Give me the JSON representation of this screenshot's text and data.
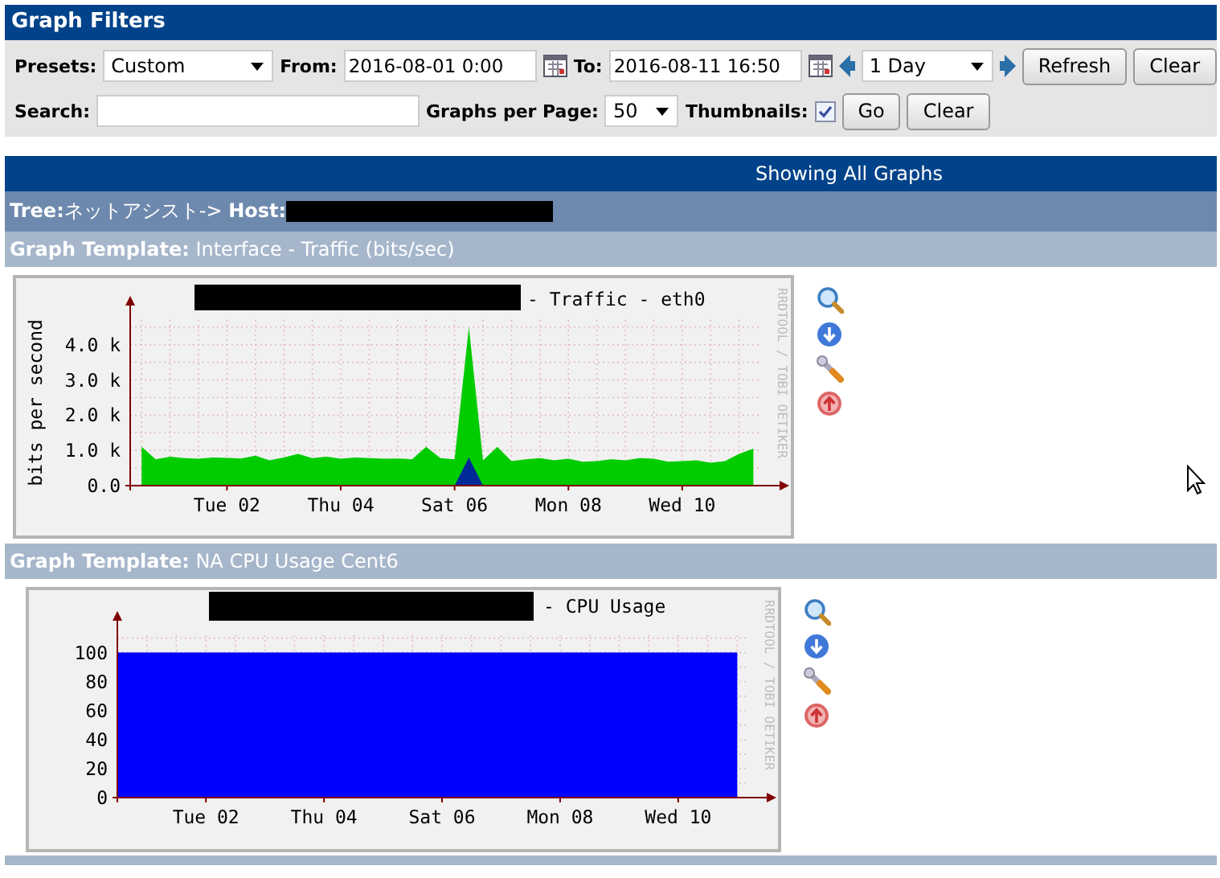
{
  "filters": {
    "title": "Graph Filters",
    "presets": {
      "label": "Presets:",
      "value": "Custom"
    },
    "from": {
      "label": "From:",
      "value": "2016-08-01 0:00"
    },
    "to": {
      "label": "To:",
      "value": "2016-08-11 16:50"
    },
    "timespan": {
      "value": "1 Day"
    },
    "buttons": [
      "Refresh",
      "Clear"
    ],
    "search": {
      "label": "Search:"
    },
    "graphs_per_page": {
      "label": "Graphs per Page:",
      "value": "50"
    },
    "thumbnails": {
      "label": "Thumbnails:",
      "checked": true
    },
    "buttons_2": [
      "Go",
      "Clear"
    ]
  },
  "banner": "Showing All Graphs",
  "tree": {
    "tree_label": "Tree:",
    "tree_value": "ネットアシスト->",
    "host_label": "Host:"
  },
  "sections": [
    {
      "template_label": "Graph Template:",
      "template_name": "Interface - Traffic (bits/sec)",
      "graph": {
        "title": "- Traffic - eth0",
        "watermark": "RRDTOOL / TOBI OETIKER",
        "chart_data": {
          "type": "area",
          "ylabel": "bits per second",
          "categories": [
            null,
            null,
            null,
            null,
            null,
            null,
            "Tue 02",
            null,
            null,
            null,
            null,
            null,
            null,
            null,
            "Thu 04",
            null,
            null,
            null,
            null,
            null,
            null,
            null,
            "Sat 06",
            null,
            null,
            null,
            null,
            null,
            null,
            null,
            "Mon 08",
            null,
            null,
            null,
            null,
            null,
            null,
            null,
            "Wed 10",
            null,
            null,
            null,
            null,
            null
          ],
          "series": [
            {
              "color": "#00cc00",
              "values": [
                1100,
                750,
                820,
                780,
                760,
                800,
                790,
                770,
                850,
                720,
                800,
                900,
                780,
                820,
                760,
                800,
                780,
                760,
                770,
                750,
                1100,
                780,
                750,
                4500,
                720,
                1100,
                700,
                750,
                780,
                720,
                760,
                680,
                700,
                750,
                720,
                780,
                760,
                680,
                700,
                720,
                650,
                700,
                900,
                1050
              ]
            },
            {
              "color": "#002a97",
              "values": [
                0,
                0,
                0,
                0,
                0,
                0,
                0,
                0,
                0,
                0,
                0,
                0,
                0,
                0,
                0,
                0,
                0,
                0,
                0,
                0,
                0,
                0,
                0,
                800,
                0,
                0,
                0,
                0,
                0,
                0,
                0,
                0,
                0,
                0,
                0,
                0,
                0,
                0,
                0,
                0,
                0,
                0,
                0,
                0
              ]
            }
          ],
          "ylim": [
            0,
            4700
          ],
          "grid": true,
          "yticks": [
            {
              "value": 0,
              "label": "0.0"
            },
            {
              "value": 1000,
              "label": "1.0 k"
            },
            {
              "value": 2000,
              "label": "2.0 k"
            },
            {
              "value": 3000,
              "label": "3.0 k"
            },
            {
              "value": 4000,
              "label": "4.0 k"
            }
          ]
        }
      }
    },
    {
      "template_label": "Graph Template:",
      "template_name": "NA CPU Usage Cent6",
      "graph": {
        "title": "- CPU Usage",
        "watermark": "RRDTOOL / TOBI OETIKER",
        "chart_data": {
          "type": "area",
          "categories": [
            null,
            null,
            null,
            "Tue 02",
            null,
            null,
            null,
            "Thu 04",
            null,
            null,
            null,
            "Sat 06",
            null,
            null,
            null,
            "Mon 08",
            null,
            null,
            null,
            "Wed 10",
            null,
            null
          ],
          "series": [
            {
              "color": "#0000ff",
              "values": [
                100,
                100,
                100,
                100,
                100,
                100,
                100,
                100,
                100,
                100,
                100,
                100,
                100,
                100,
                100,
                100,
                100,
                100,
                100,
                100,
                100,
                100
              ]
            }
          ],
          "ylim": [
            0,
            112
          ],
          "grid": true,
          "yticks": [
            0,
            20,
            40,
            60,
            80,
            100
          ]
        }
      }
    }
  ]
}
